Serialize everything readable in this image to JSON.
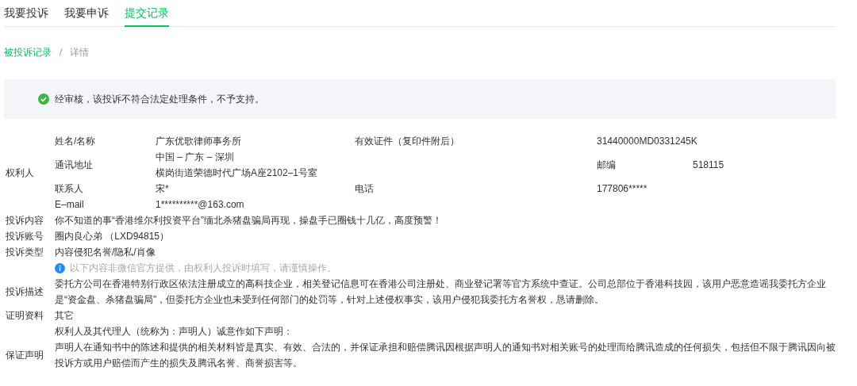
{
  "tabs": [
    {
      "label": "我要投诉",
      "selected": false
    },
    {
      "label": "我要申诉",
      "selected": false
    },
    {
      "label": "提交记录",
      "selected": true
    }
  ],
  "breadcrumb": {
    "link": "被投诉记录",
    "separator": "/",
    "current": "详情"
  },
  "notice": {
    "kind": "success",
    "text": "经审核，该投诉不符合法定处理条件，不予支持。"
  },
  "rightsholder": {
    "label": "权利人",
    "rows": [
      {
        "label": "姓名/名称",
        "value": [
          "广东优歌律师事务所"
        ],
        "label_2": "有效证件（复印件附后）",
        "value_2": "31440000MD0331245K"
      },
      {
        "label": "通讯地址",
        "value": [
          "中国 – 广东 – 深圳",
          "横岗街道荣德时代广场A座2102–1号室"
        ],
        "extra_label": "邮编",
        "extra_value": "518115"
      },
      {
        "label": "联系人",
        "value": [
          "宋*"
        ],
        "label_2": "电话",
        "value_2": "177806*****"
      },
      {
        "label": "E–mail",
        "value": [
          "1**********@163.com"
        ]
      }
    ]
  },
  "details": [
    {
      "kind": "text",
      "label": "投诉内容",
      "value": "你不知道的事“香港维尔利投资平台”缅北杀猪盘骗局再现，操盘手已圈钱十几亿，高度预警！"
    },
    {
      "kind": "text",
      "label": "投诉账号",
      "value": "圈内良心弟 （LXD94815）"
    },
    {
      "kind": "text",
      "label": "投诉类型",
      "value": "内容侵犯名誉/隐私/肖像"
    },
    {
      "kind": "hint",
      "value": "以下内容非微信官方提供，由权利人投诉时填写，请谨慎操作。"
    },
    {
      "kind": "text",
      "label": "投诉描述",
      "value": "委托方公司在香港特别行政区依法注册成立的高科技企业，相关登记信息可在香港公司注册处、商业登记署等官方系统中查证。公司总部位于香港科技园，该用户恶意造谣我委托方企业是“资金盘、杀猪盘骗局\"，但委托方企业也未受到任何部门的处罚等，针对上述侵权事实，该用户侵犯我委托方名誉权，恳请删除。"
    },
    {
      "kind": "text",
      "label": "证明资料",
      "value": "其它"
    },
    {
      "kind": "text",
      "value": "权利人及其代理人（统称为：声明人）诚意作如下声明："
    },
    {
      "kind": "text",
      "label": "保证声明",
      "value": "声明人在通知书中的陈述和提供的相关材料皆是真实、有效、合法的，并保证承担和赔偿腾讯因根据声明人的通知书对相关账号的处理而给腾讯造成的任何损失，包括但不限于腾讯因向被投诉方或用户赔偿而产生的损失及腾讯名誉、商誉损害等。"
    }
  ]
}
